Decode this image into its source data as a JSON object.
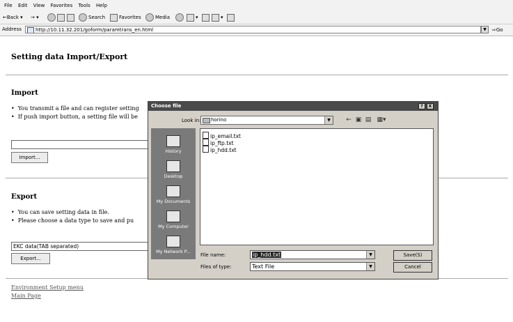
{
  "browser": {
    "menu": [
      "File",
      "Edit",
      "View",
      "Favorites",
      "Tools",
      "Help"
    ],
    "toolbar": {
      "back": "Back",
      "search": "Search",
      "favorites": "Favorites",
      "media": "Media"
    },
    "address_label": "Address",
    "address_url": "http://10.11.32.201/goform/paramtrans_en.html",
    "go_label": "Go"
  },
  "page": {
    "title": "Setting data Import/Export",
    "import": {
      "heading": "Import",
      "bullets": [
        "You transmit a file and can register setting",
        "If push import button, a setting file will be"
      ],
      "button": "Import..."
    },
    "export": {
      "heading": "Export",
      "bullets": [
        "You can save setting data in file.",
        "Please choose a data type to save and pu"
      ],
      "select_value": "EKC data(TAB separated)",
      "button": "Export..."
    },
    "links": [
      "Environment Setup menu",
      "Main Page"
    ]
  },
  "dialog": {
    "title": "Choose file",
    "title_buttons": [
      "?",
      "X"
    ],
    "look_in_label": "Look in:",
    "look_in_value": "horino",
    "places": [
      "History",
      "Desktop",
      "My Documents",
      "My Computer",
      "My Network P..."
    ],
    "files": [
      "ip_email.txt",
      "ip_ftp.txt",
      "ip_hdd.txt"
    ],
    "file_name_label": "File name:",
    "file_name_value": "ip_hdd.txt",
    "file_type_label": "Files of type:",
    "file_type_value": "Text File",
    "save_button": "Save(S)",
    "cancel_button": "Cancel"
  }
}
